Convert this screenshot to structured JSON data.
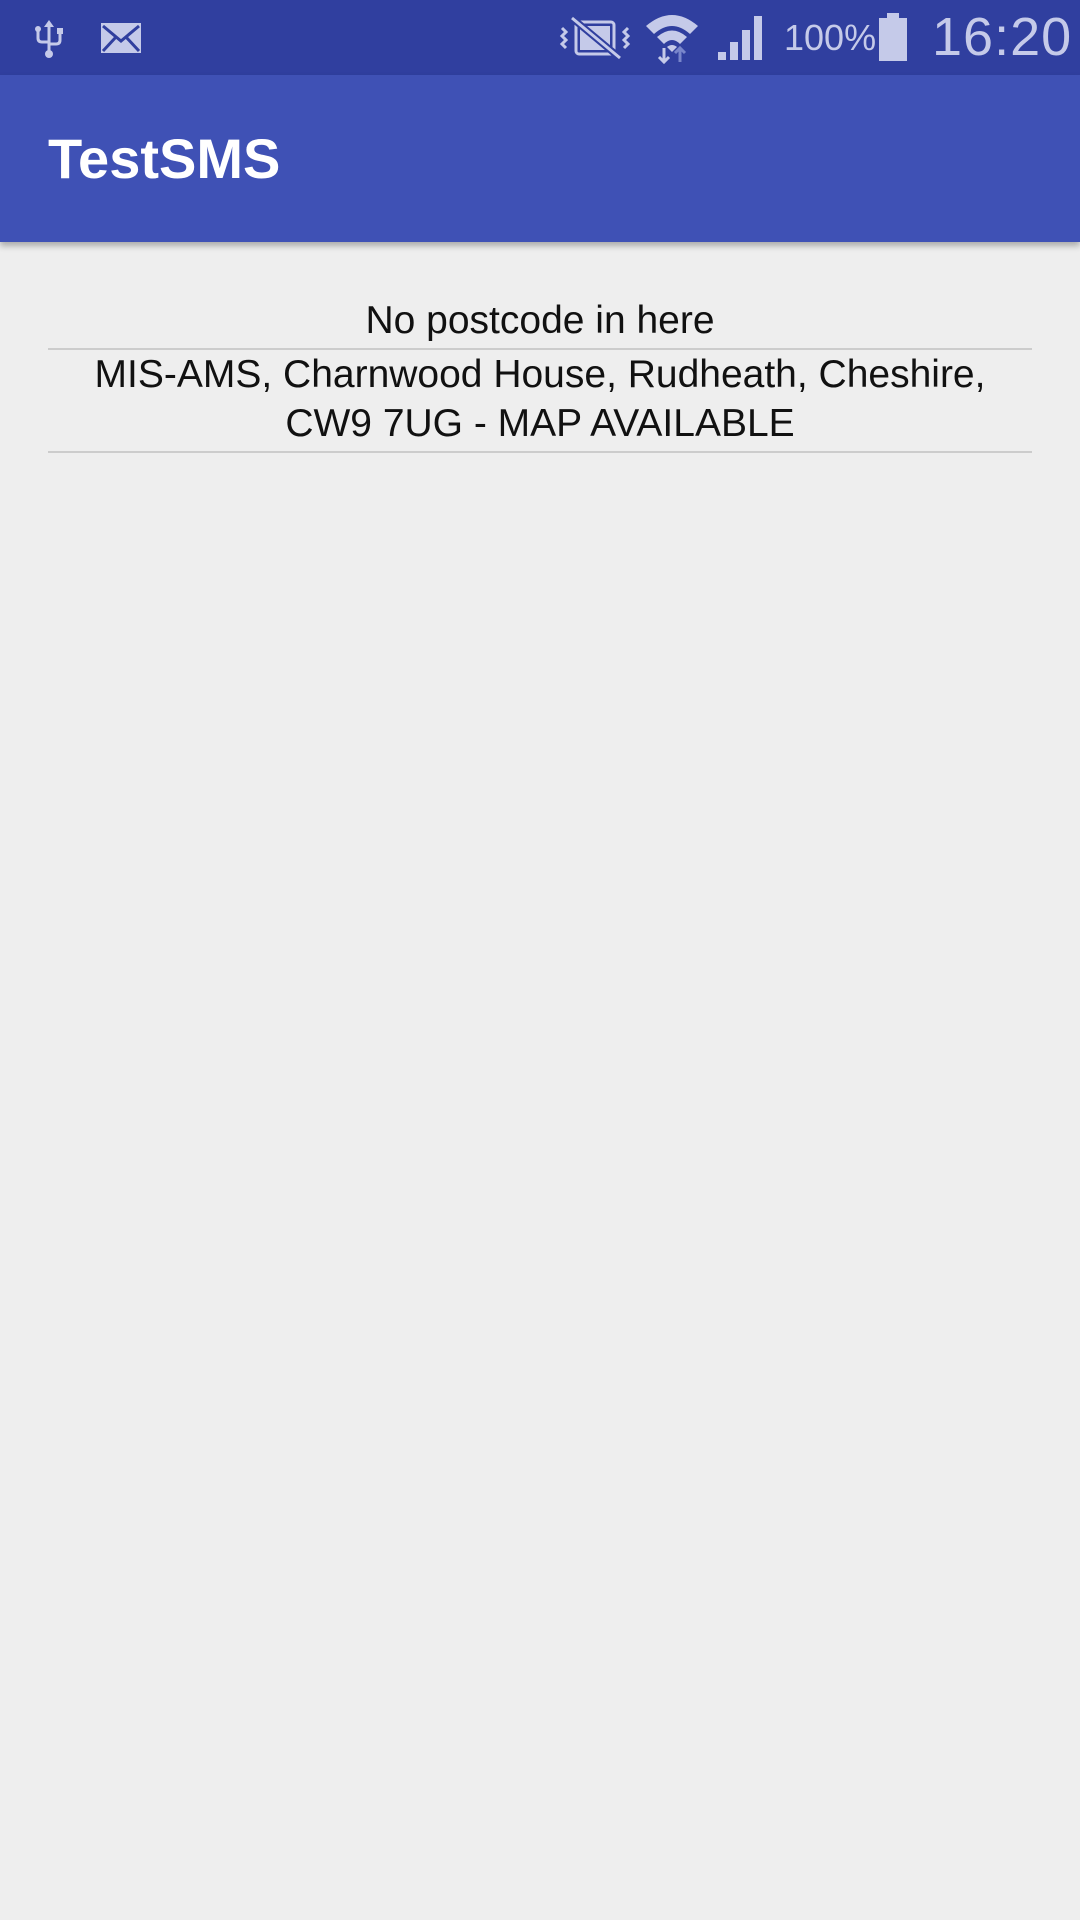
{
  "status_bar": {
    "icons": [
      "usb-icon",
      "mail-icon",
      "vibrate-icon",
      "wifi-icon",
      "signal-icon",
      "battery-icon"
    ],
    "battery_percent": "100%",
    "time": "16:20",
    "colors": {
      "background": "#303f9f",
      "icons": "#c5cae9"
    }
  },
  "app_bar": {
    "title": "TestSMS",
    "color": "#3f51b5"
  },
  "messages": [
    {
      "text": "No postcode in here"
    },
    {
      "text": "MIS-AMS, Charnwood House, Rudheath, Cheshire, CW9 7UG - MAP AVAILABLE"
    }
  ]
}
